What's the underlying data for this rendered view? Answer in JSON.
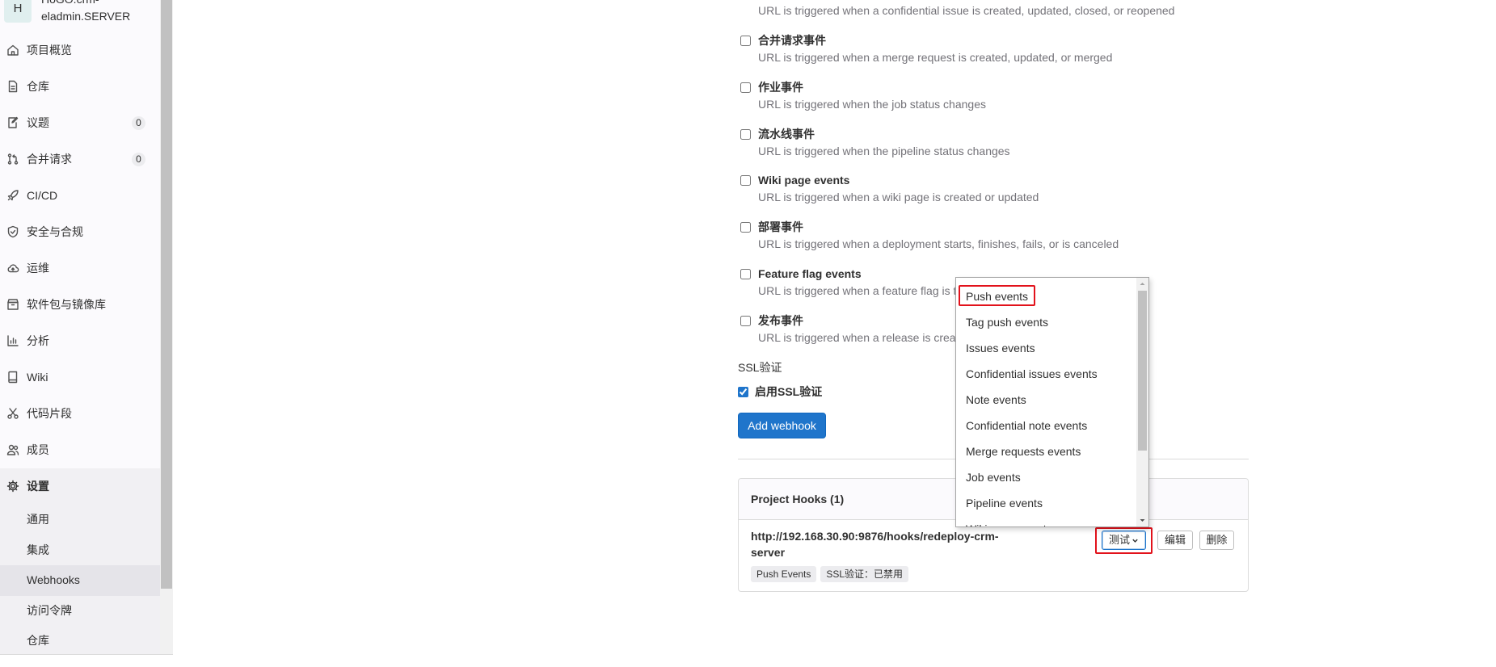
{
  "project": {
    "avatar_letter": "H",
    "name_line1": "HoGO.crm-",
    "name_line2": "eladmin.SERVER"
  },
  "sidebar": {
    "items": [
      {
        "label": "项目概览",
        "icon": "home-icon"
      },
      {
        "label": "仓库",
        "icon": "document-icon"
      },
      {
        "label": "议题",
        "icon": "issues-icon",
        "badge": "0"
      },
      {
        "label": "合并请求",
        "icon": "merge-request-icon",
        "badge": "0"
      },
      {
        "label": "CI/CD",
        "icon": "rocket-icon"
      },
      {
        "label": "安全与合规",
        "icon": "shield-icon"
      },
      {
        "label": "运维",
        "icon": "cloud-icon"
      },
      {
        "label": "软件包与镜像库",
        "icon": "package-icon"
      },
      {
        "label": "分析",
        "icon": "chart-icon"
      },
      {
        "label": "Wiki",
        "icon": "book-icon"
      },
      {
        "label": "代码片段",
        "icon": "snippet-icon"
      },
      {
        "label": "成员",
        "icon": "users-icon"
      }
    ],
    "settings": {
      "label": "设置",
      "icon": "gear-icon",
      "active": true
    },
    "settings_sub_items": [
      {
        "label": "通用"
      },
      {
        "label": "集成"
      },
      {
        "label": "Webhooks",
        "active": true
      },
      {
        "label": "访问令牌"
      },
      {
        "label": "仓库"
      }
    ]
  },
  "trigger_events": {
    "confidential_issues_description": "URL is triggered when a confidential issue is created, updated, closed, or reopened",
    "events": [
      {
        "label": "合并请求事件",
        "description": "URL is triggered when a merge request is created, updated, or merged",
        "checked": false
      },
      {
        "label": "作业事件",
        "description": "URL is triggered when the job status changes",
        "checked": false
      },
      {
        "label": "流水线事件",
        "description": "URL is triggered when the pipeline status changes",
        "checked": false
      },
      {
        "label": "Wiki page events",
        "description": "URL is triggered when a wiki page is created or updated",
        "checked": false
      },
      {
        "label": "部署事件",
        "description": "URL is triggered when a deployment starts, finishes, fails, or is canceled",
        "checked": false
      },
      {
        "label": "Feature flag events",
        "description": "URL is triggered when a feature flag is t",
        "checked": false
      },
      {
        "label": "发布事件",
        "description": "URL is triggered when a release is creat",
        "checked": false
      }
    ]
  },
  "ssl_verification": {
    "heading": "SSL验证",
    "checkbox_label": "启用SSL验证",
    "checked": true
  },
  "add_webhook_button": "Add webhook",
  "project_hooks": {
    "title": "Project Hooks (1)",
    "hooks": [
      {
        "url": "http://192.168.30.90:9876/hooks/redeploy-crm-server",
        "badges": [
          "Push Events",
          "SSL验证：已禁用"
        ],
        "test_button": "测试",
        "edit_button": "编辑",
        "delete_button": "删除"
      }
    ]
  },
  "test_dropdown": {
    "open": true,
    "options": [
      "Push events",
      "Tag push events",
      "Issues events",
      "Confidential issues events",
      "Note events",
      "Confidential note events",
      "Merge requests events",
      "Job events",
      "Pipeline events",
      "Wiki page events"
    ],
    "highlighted_index": 0
  },
  "colors": {
    "primary": "#1f75cb",
    "annotation_red": "#e2121b",
    "text": "#303030",
    "muted_text": "#737278",
    "sidebar_bg": "#fbfafd"
  }
}
